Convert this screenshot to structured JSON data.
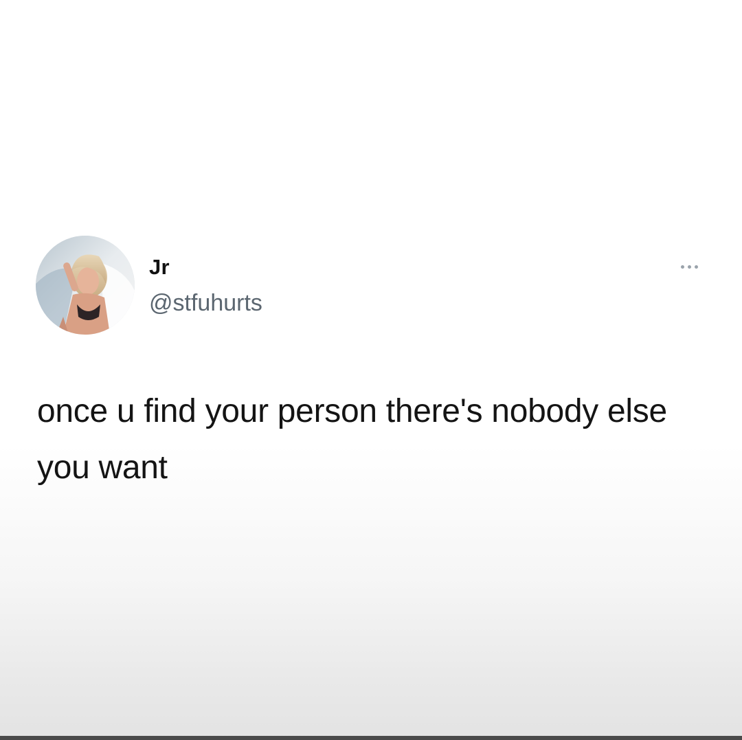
{
  "tweet": {
    "display_name": "Jr",
    "handle": "@stfuhurts",
    "text": "once u find your person there's nobody else you want",
    "more_icon": "more-horizontal-icon",
    "avatar_icon": "profile-photo"
  },
  "colors": {
    "name": "#111111",
    "handle": "#5b6670",
    "body_text": "#141414",
    "more_dots": "#9aa3ab",
    "bottom_bar": "#4a4a4a"
  }
}
